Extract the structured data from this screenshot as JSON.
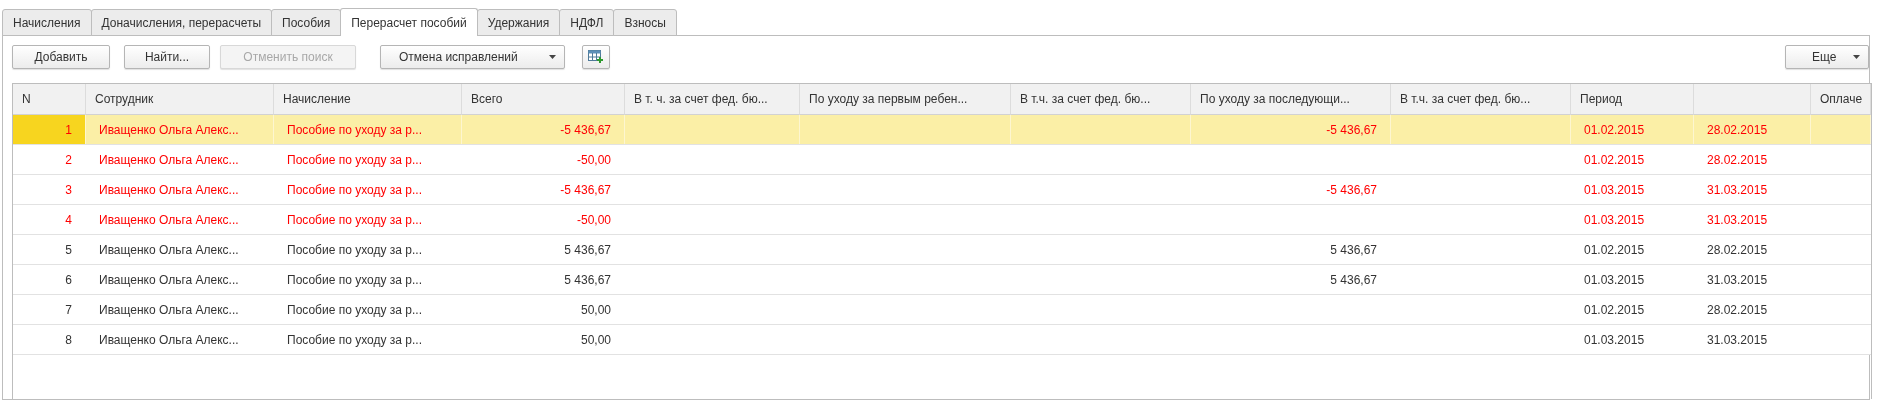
{
  "tabs": [
    {
      "label": "Начисления",
      "selected": false
    },
    {
      "label": "Доначисления, перерасчеты",
      "selected": false
    },
    {
      "label": "Пособия",
      "selected": false
    },
    {
      "label": "Перерасчет пособий",
      "selected": true
    },
    {
      "label": "Удержания",
      "selected": false
    },
    {
      "label": "НДФЛ",
      "selected": false
    },
    {
      "label": "Взносы",
      "selected": false
    }
  ],
  "toolbar": {
    "buttons": [
      {
        "kind": "text",
        "label": "Добавить",
        "disabled": false
      },
      {
        "kind": "text",
        "label": "Найти...",
        "disabled": false
      },
      {
        "kind": "text",
        "label": "Отменить поиск",
        "disabled": true
      },
      {
        "kind": "dropdown",
        "label": "Отмена исправлений",
        "disabled": false
      },
      {
        "kind": "icon",
        "disabled": false
      }
    ],
    "more_button": {
      "label": "Еще"
    }
  },
  "table": {
    "columns": [
      {
        "title": "N"
      },
      {
        "title": "Сотрудник"
      },
      {
        "title": "Начисление"
      },
      {
        "title": "Всего"
      },
      {
        "title": "В т. ч. за счет фед. бю..."
      },
      {
        "title": "По уходу за первым ребен..."
      },
      {
        "title": "В т.ч. за счет фед. бю..."
      },
      {
        "title": "По уходу за последующи..."
      },
      {
        "title": "В т.ч. за счет фед. бю..."
      },
      {
        "title": "Период"
      },
      {},
      {
        "title": "Оплаче"
      }
    ],
    "rows": [
      {
        "selected": true,
        "storno": true,
        "cells": [
          "1",
          "Иващенко Ольга Алекс...",
          "Пособие по уходу за р...",
          "-5 436,67",
          null,
          null,
          null,
          "-5 436,67",
          null,
          "01.02.2015",
          "28.02.2015",
          null
        ]
      },
      {
        "selected": false,
        "storno": true,
        "cells": [
          "2",
          "Иващенко Ольга Алекс...",
          "Пособие по уходу за р...",
          "-50,00",
          null,
          null,
          null,
          null,
          null,
          "01.02.2015",
          "28.02.2015",
          null
        ]
      },
      {
        "selected": false,
        "storno": true,
        "cells": [
          "3",
          "Иващенко Ольга Алекс...",
          "Пособие по уходу за р...",
          "-5 436,67",
          null,
          null,
          null,
          "-5 436,67",
          null,
          "01.03.2015",
          "31.03.2015",
          null
        ]
      },
      {
        "selected": false,
        "storno": true,
        "cells": [
          "4",
          "Иващенко Ольга Алекс...",
          "Пособие по уходу за р...",
          "-50,00",
          null,
          null,
          null,
          null,
          null,
          "01.03.2015",
          "31.03.2015",
          null
        ]
      },
      {
        "selected": false,
        "storno": false,
        "cells": [
          "5",
          "Иващенко Ольга Алекс...",
          "Пособие по уходу за р...",
          "5 436,67",
          null,
          null,
          null,
          "5 436,67",
          null,
          "01.02.2015",
          "28.02.2015",
          null
        ]
      },
      {
        "selected": false,
        "storno": false,
        "cells": [
          "6",
          "Иващенко Ольга Алекс...",
          "Пособие по уходу за р...",
          "5 436,67",
          null,
          null,
          null,
          "5 436,67",
          null,
          "01.03.2015",
          "31.03.2015",
          null
        ]
      },
      {
        "selected": false,
        "storno": false,
        "cells": [
          "7",
          "Иващенко Ольга Алекс...",
          "Пособие по уходу за р...",
          "50,00",
          null,
          null,
          null,
          null,
          null,
          "01.02.2015",
          "28.02.2015",
          null
        ]
      },
      {
        "selected": false,
        "storno": false,
        "cells": [
          "8",
          "Иващенко Ольга Алекс...",
          "Пособие по уходу за р...",
          "50,00",
          null,
          null,
          null,
          null,
          null,
          "01.03.2015",
          "31.03.2015",
          null
        ]
      }
    ]
  }
}
